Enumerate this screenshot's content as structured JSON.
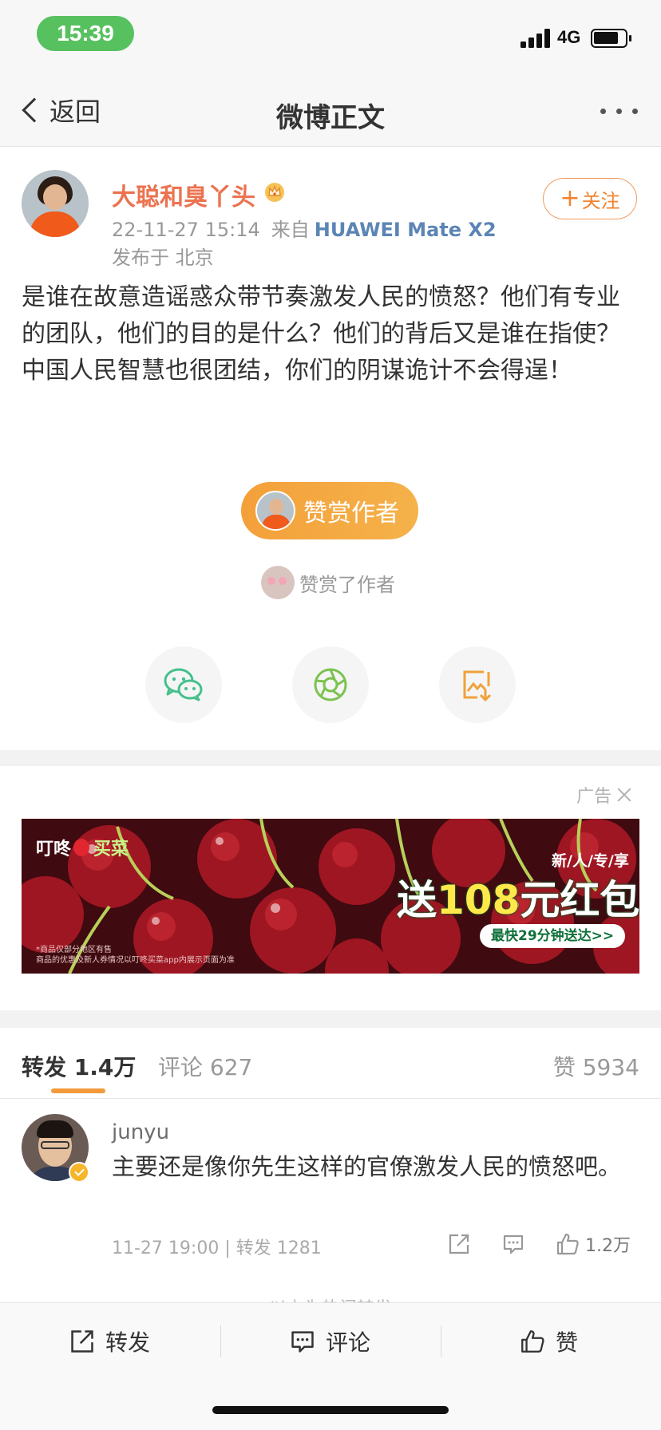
{
  "status_bar": {
    "time": "15:39",
    "network": "4G"
  },
  "nav": {
    "back_label": "返回",
    "title": "微博正文"
  },
  "post": {
    "author": "大聪和臭丫头",
    "timestamp": "22-11-27 15:14",
    "source_prefix": "来自",
    "device": "HUAWEI Mate X2",
    "location": "发布于 北京",
    "follow_label": "关注",
    "text": "是谁在故意造谣惑众带节奏激发人民的愤怒？他们有专业的团队，他们的目的是什么？他们的背后又是谁在指使？中国人民智慧也很团结，你们的阴谋诡计不会得逞！"
  },
  "reward": {
    "button_label": "赞赏作者",
    "rewarded_text": "赞赏了作者"
  },
  "ad": {
    "label": "广告",
    "brand_part1": "叮咚",
    "brand_part2": "买菜",
    "tag": "新/人/专/享",
    "headline_pre": "送",
    "headline_num": "108",
    "headline_post": "元红包",
    "cta": "最快29分钟送达>>",
    "fine_print_1": "*商品仅部分地区有售",
    "fine_print_2": "商品的优惠及新人券情况以叮咚买菜app内展示页面为准"
  },
  "tabs": {
    "repost_label": "转发",
    "repost_count": "1.4万",
    "comment_label": "评论",
    "comment_count": "627",
    "like_label": "赞",
    "like_count": "5934"
  },
  "reposts": [
    {
      "username": "junyu",
      "text": "主要还是像你先生这样的官僚激发人民的愤怒吧。",
      "meta": "11-27 19:00 | 转发 1281",
      "likes": "1.2万"
    }
  ],
  "hidden_notice": "以上为热门转发",
  "toolbar": {
    "repost": "转发",
    "comment": "评论",
    "like": "赞"
  },
  "colors": {
    "accent_orange": "#eb7350",
    "device_blue": "#5b85b5",
    "status_green": "#57c15f",
    "wechat_green": "#44c08c"
  }
}
